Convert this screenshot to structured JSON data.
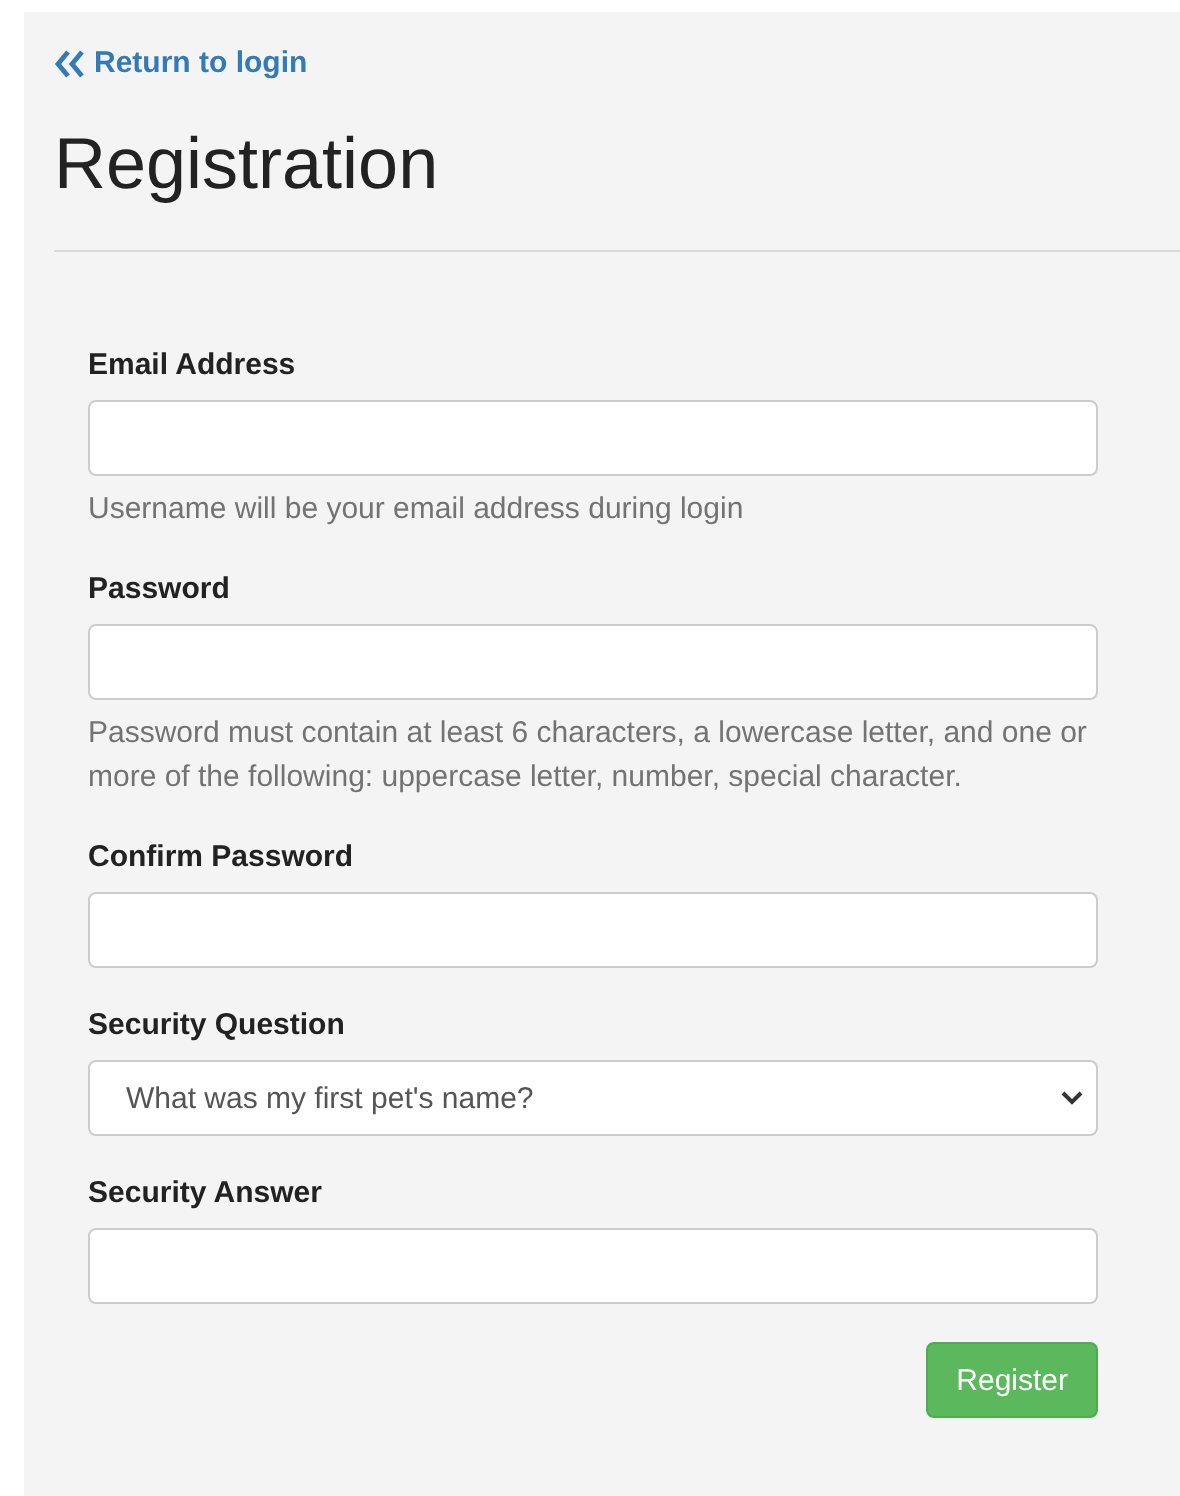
{
  "back_link": {
    "label": "Return to login"
  },
  "title": "Registration",
  "fields": [
    {
      "kind": "text",
      "label": "Email Address",
      "help": "Username will be your email address during login"
    },
    {
      "kind": "text",
      "label": "Password",
      "help": "Password must contain at least 6 characters, a lowercase letter, and one or more of the following: uppercase letter, number, special character."
    },
    {
      "kind": "text",
      "label": "Confirm Password"
    },
    {
      "kind": "select",
      "label": "Security Question",
      "value": "What was my first pet's name?"
    },
    {
      "kind": "text",
      "label": "Security Answer"
    }
  ],
  "submit": {
    "label": "Register"
  }
}
